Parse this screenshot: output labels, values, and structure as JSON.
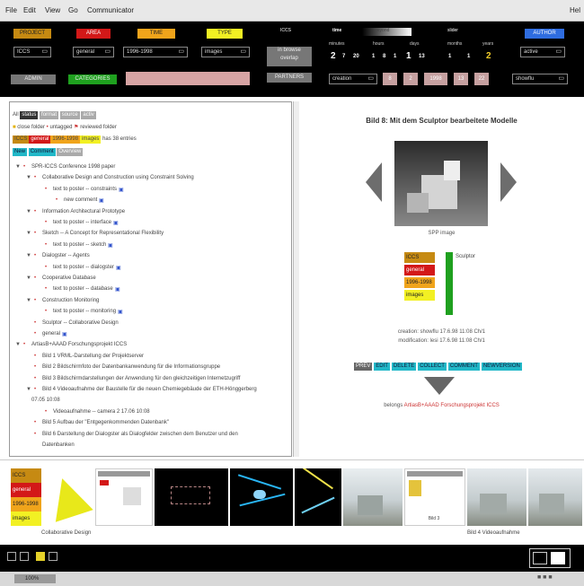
{
  "menubar": {
    "items": [
      "File",
      "Edit",
      "View",
      "Go",
      "Communicator"
    ],
    "right": "Hel"
  },
  "topbar": {
    "labels": {
      "project": "PROJECT",
      "area": "AREA",
      "time": "TIME",
      "type": "TYPE",
      "author": "AUTHOR"
    },
    "selects": {
      "project": "ICCS",
      "area": "general",
      "time": "1996-1998",
      "type": "images",
      "author": "active",
      "sort": "creation",
      "filter": "showflu"
    },
    "buttons": {
      "admin": "ADMIN",
      "categories": "CATEGORIES",
      "browse": "in browse",
      "overlap": "overlap",
      "partners": "PARTNERS",
      "iccs": "ICCS"
    },
    "time": {
      "label": "time",
      "mode": "beyond",
      "slider_label": "slider"
    },
    "units": [
      "minutes",
      "hours",
      "days",
      "months",
      "years"
    ],
    "values": [
      "2",
      "7",
      "20",
      "1",
      "8",
      "1",
      "1",
      "13",
      "1",
      "1",
      "2"
    ],
    "date_fields": [
      "8",
      "2",
      "1998",
      "13",
      "22"
    ],
    "colors": {
      "project": "#c68a12",
      "area": "#d31818",
      "time": "#f0a41b",
      "type": "#f2f023",
      "author": "#2f6de0",
      "categories": "#1fa01f",
      "pink": "#d7a4a4"
    }
  },
  "tree": {
    "modes": [
      "All",
      "status",
      "format",
      "source",
      "activ"
    ],
    "legend": [
      "close folder",
      "untagged",
      "reviewed folder"
    ],
    "tags": [
      "ICCS",
      "general",
      "1996-1998",
      "images"
    ],
    "tags_suffix": "has 38 entries",
    "actions": [
      "New",
      "Comment",
      "Overview"
    ],
    "rows": [
      {
        "text": "SPR-ICCS Conference 1998 paper",
        "indent": 0,
        "kind": "open"
      },
      {
        "text": "Collaborative Design and Construction using Constraint Solving",
        "indent": 1,
        "kind": "open"
      },
      {
        "text": "text to poster -- constraints",
        "indent": 2,
        "kind": "link"
      },
      {
        "text": "new comment",
        "indent": 3,
        "kind": "link"
      },
      {
        "text": "Information Architectural Prototype",
        "indent": 1,
        "kind": "open"
      },
      {
        "text": "text to poster -- interface",
        "indent": 2,
        "kind": "link"
      },
      {
        "text": "Sketch -- A Concept for Representational Flexibility",
        "indent": 1,
        "kind": "open"
      },
      {
        "text": "text to poster -- sketch",
        "indent": 2,
        "kind": "link"
      },
      {
        "text": "Dialogster -- Agents",
        "indent": 1,
        "kind": "open"
      },
      {
        "text": "text to poster -- dialogster",
        "indent": 2,
        "kind": "link"
      },
      {
        "text": "Cooperative Database",
        "indent": 1,
        "kind": "open"
      },
      {
        "text": "text to poster -- database",
        "indent": 2,
        "kind": "link"
      },
      {
        "text": "Construction Monitoring",
        "indent": 1,
        "kind": "open"
      },
      {
        "text": "text to poster -- monitoring",
        "indent": 2,
        "kind": "link"
      },
      {
        "text": "Sculptor -- Collaborative Design",
        "indent": 1,
        "kind": "item"
      },
      {
        "text": "general",
        "indent": 1,
        "kind": "link"
      },
      {
        "text": "ArtiasB+AAAD Forschungsprojekt ICCS",
        "indent": 0,
        "kind": "open"
      },
      {
        "text": "Bild 1 VRML-Darstellung der Projektserver",
        "indent": 1,
        "kind": "item"
      },
      {
        "text": "Bild 2 Bildschirmfoto der Datenbankanwendung für die Informationsgruppe",
        "indent": 1,
        "kind": "item"
      },
      {
        "text": "Bild 3 Bildschirmdarstellungen der Anwendung für den gleichzeitigen Internetzugriff",
        "indent": 1,
        "kind": "item"
      },
      {
        "text": "Bild 4 Videoaufnahme der Baustelle für die neuen Chemiegebäude der ETH-Hönggerberg",
        "indent": 1,
        "kind": "open"
      },
      {
        "text": "07.05 10:08",
        "indent": 0,
        "kind": "plain"
      },
      {
        "text": "Videoaufnahme -- camera 2 17.06 10:08",
        "indent": 2,
        "kind": "item"
      },
      {
        "text": "Bild 5 Aufbau der \"Entgegenkommenden Datenbank\"",
        "indent": 1,
        "kind": "item"
      },
      {
        "text": "Bild 6 Darstellung der Dialogster als Dialogfelder zwischen dem Benutzer und den",
        "indent": 1,
        "kind": "item"
      },
      {
        "text": "Datenbanken",
        "indent": 1,
        "kind": "plain"
      }
    ]
  },
  "detail": {
    "title": "Bild 8: Mit dem Sculptor bearbeitete Modelle",
    "image_caption": "SPP image",
    "tags": [
      "ICCS",
      "general",
      "1996-1998",
      "images"
    ],
    "category": "Sculptor",
    "creation": "creation: showflu 17.6.98 11:08 Ch/1",
    "modification": "modification: lesi 17.6.98 11:08 Ch/1",
    "actions": [
      "PREV",
      "EDIT",
      "DELETE",
      "COLLECT",
      "COMMENT",
      "NEWVERSION"
    ],
    "belongs_label": "belongs",
    "belongs_link": "ArtiasB+AAAD Forschungsprojekt ICCS"
  },
  "thumbs": {
    "tags": [
      "ICCS",
      "general",
      "1996-1998",
      "images"
    ],
    "captions": [
      "Collaborative Design",
      "Bild 3",
      "Bild 4 Videoaufnahme"
    ]
  },
  "status": {
    "left": "100%"
  }
}
